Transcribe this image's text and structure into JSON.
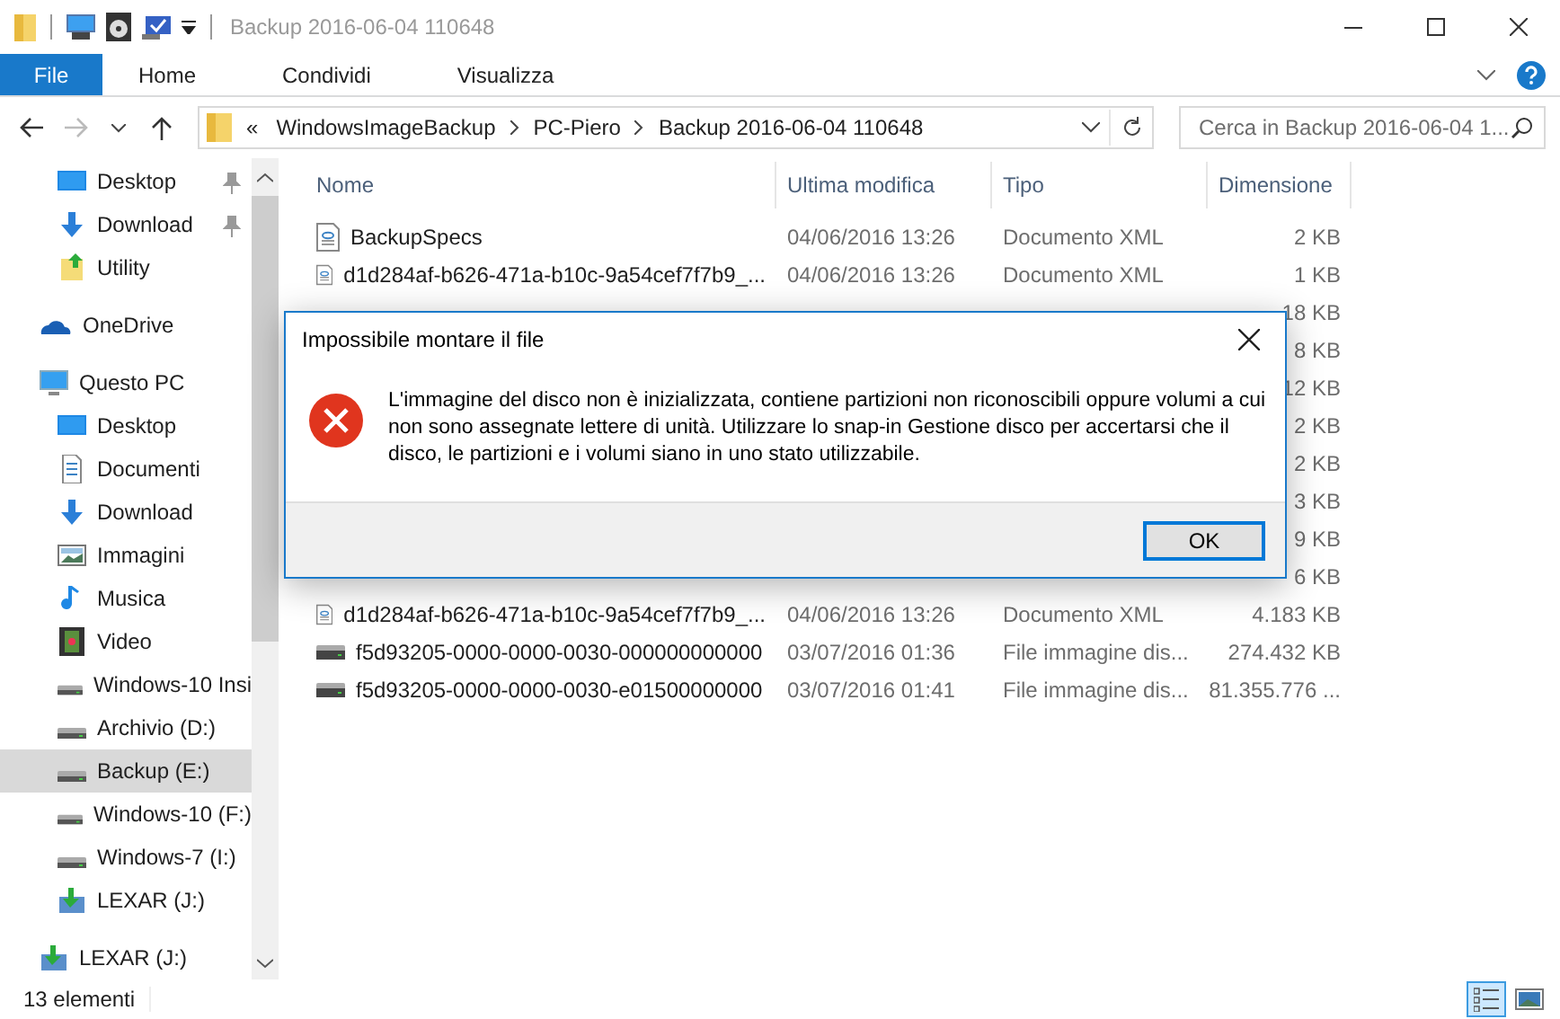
{
  "window": {
    "title": "Backup 2016-06-04 110648"
  },
  "ribbon_tabs": [
    {
      "label": "File",
      "selected": true
    },
    {
      "label": "Home",
      "selected": false
    },
    {
      "label": "Condividi",
      "selected": false
    },
    {
      "label": "Visualizza",
      "selected": false
    }
  ],
  "address": {
    "overflow": "«",
    "crumbs": [
      "WindowsImageBackup",
      "PC-Piero",
      "Backup 2016-06-04 110648"
    ]
  },
  "search": {
    "placeholder": "Cerca in Backup 2016-06-04 1..."
  },
  "nav": {
    "quick_access": [
      {
        "label": "Desktop",
        "kind": "desktop",
        "pinned": true,
        "selected": false
      },
      {
        "label": "Download",
        "kind": "download",
        "pinned": true,
        "selected": false
      },
      {
        "label": "Utility",
        "kind": "folder",
        "pinned": false,
        "selected": false
      }
    ],
    "items": [
      {
        "label": "OneDrive",
        "kind": "cloud",
        "selected": false
      },
      {
        "label": "Questo PC",
        "kind": "pc",
        "selected": false,
        "children": [
          {
            "label": "Desktop",
            "kind": "desktop",
            "selected": false
          },
          {
            "label": "Documenti",
            "kind": "documents",
            "selected": false
          },
          {
            "label": "Download",
            "kind": "download",
            "selected": false
          },
          {
            "label": "Immagini",
            "kind": "pictures",
            "selected": false
          },
          {
            "label": "Musica",
            "kind": "music",
            "selected": false
          },
          {
            "label": "Video",
            "kind": "video",
            "selected": false
          },
          {
            "label": "Windows-10 Insi",
            "kind": "drive",
            "selected": false
          },
          {
            "label": "Archivio (D:)",
            "kind": "drive",
            "selected": false
          },
          {
            "label": "Backup (E:)",
            "kind": "drive",
            "selected": true
          },
          {
            "label": "Windows-10 (F:)",
            "kind": "drive",
            "selected": false
          },
          {
            "label": "Windows-7 (I:)",
            "kind": "drive",
            "selected": false
          },
          {
            "label": "LEXAR (J:)",
            "kind": "usb",
            "selected": false
          }
        ]
      },
      {
        "label": "LEXAR (J:)",
        "kind": "usb",
        "selected": false
      }
    ]
  },
  "table": {
    "columns": [
      "Nome",
      "Ultima modifica",
      "Tipo",
      "Dimensione"
    ],
    "rows": [
      {
        "kind": "xml",
        "name": "BackupSpecs",
        "modified": "04/06/2016 13:26",
        "type": "Documento XML",
        "size": "2 KB"
      },
      {
        "kind": "xml",
        "name": "d1d284af-b626-471a-b10c-9a54cef7f7b9_...",
        "modified": "04/06/2016 13:26",
        "type": "Documento XML",
        "size": "1 KB"
      },
      {
        "size": "18 KB"
      },
      {
        "size": "8 KB"
      },
      {
        "size": "12 KB"
      },
      {
        "size": "2 KB"
      },
      {
        "size": "2 KB"
      },
      {
        "size": "3 KB"
      },
      {
        "size": "9 KB"
      },
      {
        "size": "6 KB"
      },
      {
        "kind": "xml",
        "name": "d1d284af-b626-471a-b10c-9a54cef7f7b9_...",
        "modified": "04/06/2016 13:26",
        "type": "Documento XML",
        "size": "4.183 KB"
      },
      {
        "kind": "disk",
        "name": "f5d93205-0000-0000-0030-000000000000",
        "modified": "03/07/2016 01:36",
        "type": "File immagine dis...",
        "size": "274.432 KB"
      },
      {
        "kind": "disk",
        "name": "f5d93205-0000-0000-0030-e01500000000",
        "modified": "03/07/2016 01:41",
        "type": "File immagine dis...",
        "size": "81.355.776 ..."
      }
    ]
  },
  "status_bar": {
    "count": "13 elementi",
    "views": [
      {
        "kind": "details",
        "selected": true
      },
      {
        "kind": "large",
        "selected": false
      }
    ]
  },
  "dialog": {
    "title": "Impossibile montare il file",
    "message": "L'immagine del disco non è inizializzata, contiene partizioni non riconoscibili oppure volumi a cui non sono assegnate lettere di unità. Utilizzare lo snap-in Gestione disco per accertarsi che il disco, le partizioni e i volumi siano in uno stato utilizzabile.",
    "buttons": [
      "OK"
    ]
  }
}
